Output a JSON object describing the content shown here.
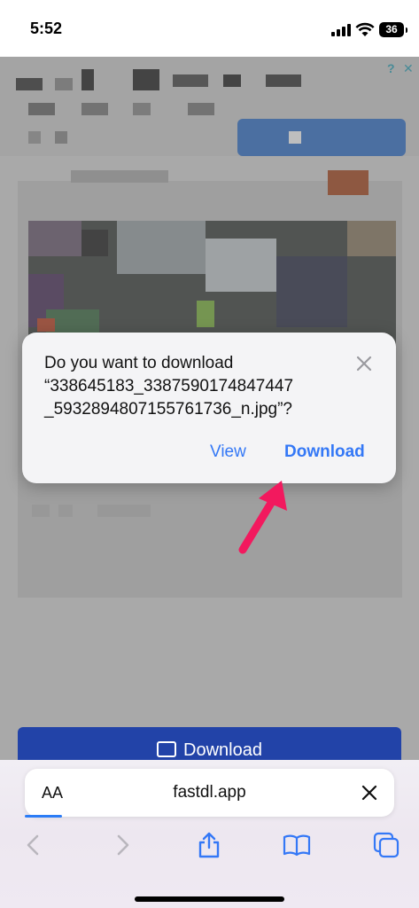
{
  "status_bar": {
    "time": "5:52",
    "battery": "36"
  },
  "dialog": {
    "message_line1": "Do you want to download",
    "message_line2": "“338645183_3387590174847447",
    "message_line3": "_5932894807155761736_n.jpg”?",
    "view_label": "View",
    "download_label": "Download"
  },
  "page": {
    "download_button_label": "Download"
  },
  "browser": {
    "text_size_label": "AA",
    "url": "fastdl.app",
    "accent_color": "#3478f6"
  },
  "icons": [
    "signal-icon",
    "wifi-icon",
    "battery-icon",
    "close-icon",
    "arrow-annotation",
    "image-icon",
    "back-icon",
    "forward-icon",
    "share-icon",
    "bookmarks-icon",
    "tabs-icon"
  ]
}
